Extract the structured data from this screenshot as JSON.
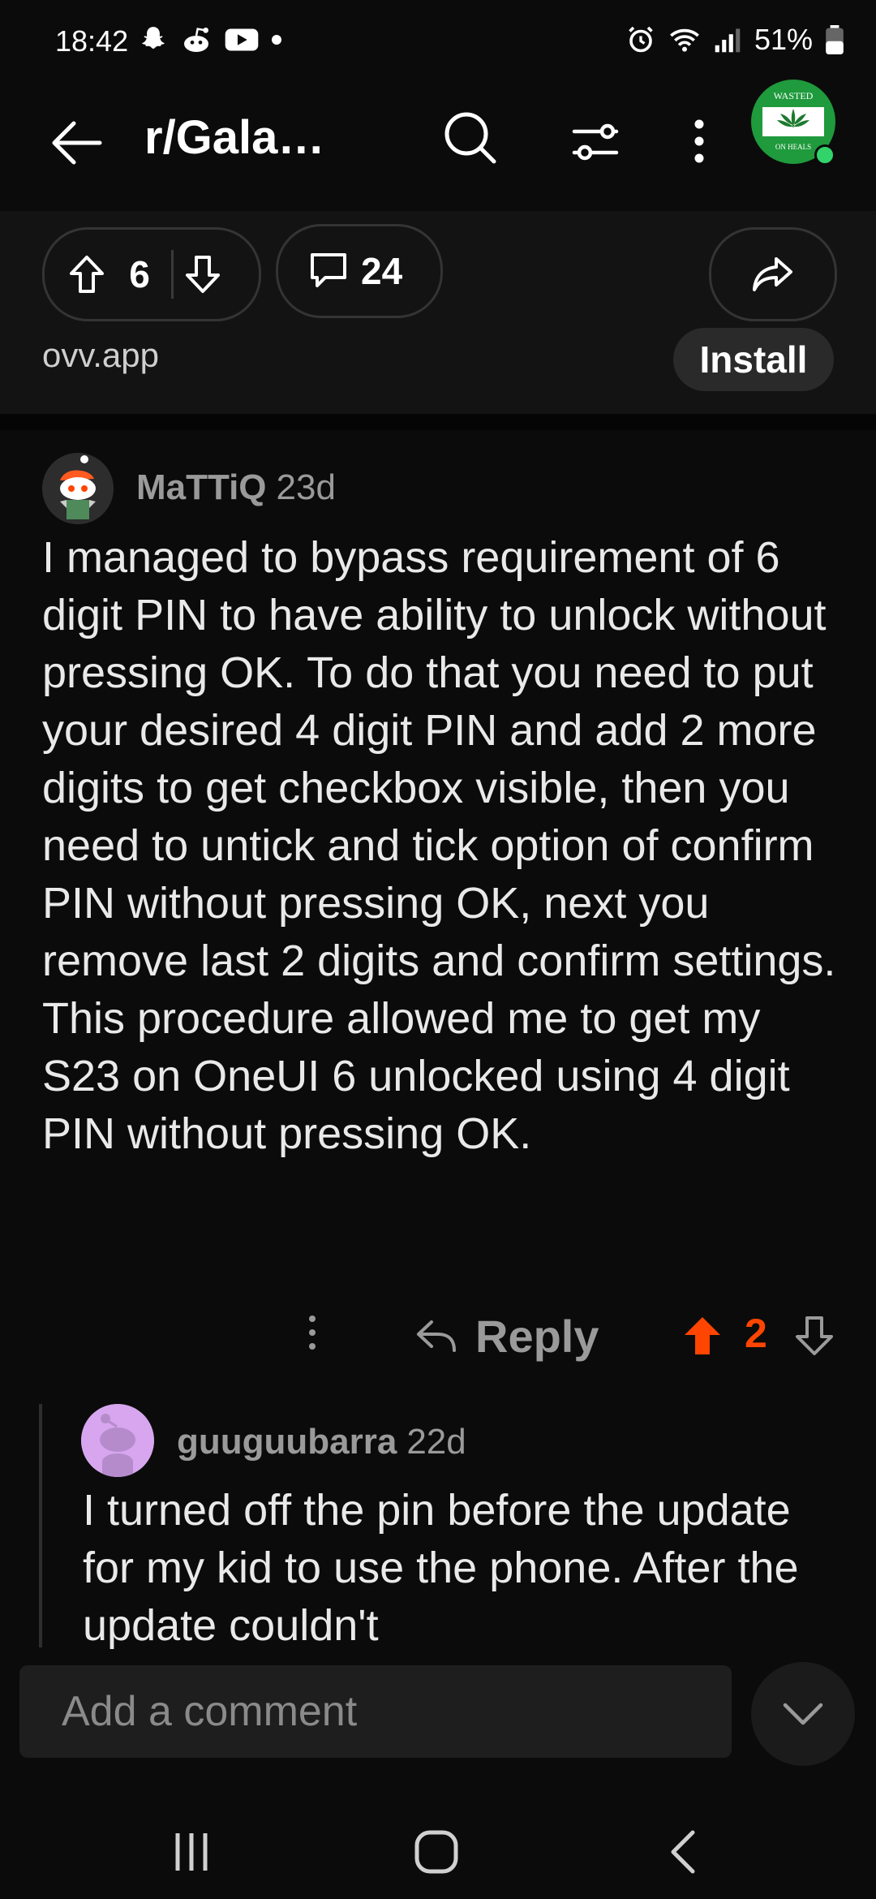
{
  "status_bar": {
    "time": "18:42",
    "battery": "51%"
  },
  "app_bar": {
    "title": "r/Gala…",
    "avatar_text_top": "WASTED",
    "avatar_text_bottom": "ON HEALS"
  },
  "post": {
    "votes": "6",
    "comments": "24",
    "domain": "ovv.app",
    "install_label": "Install"
  },
  "comment": {
    "author": "MaTTiQ",
    "age": "23d",
    "body": "I managed to bypass requirement of 6 digit PIN to have ability to unlock without pressing OK. To do that you need to put your desired 4 digit PIN and add 2 more digits to get checkbox visible, then you need to untick and tick option of confirm PIN without pressing OK, next you remove last 2 digits and confirm settings. This procedure allowed me to get my S23 on OneUI 6 unlocked using 4 digit PIN without pressing OK.",
    "reply_label": "Reply",
    "score": "2"
  },
  "reply": {
    "author": "guuguubarra",
    "age": "22d",
    "body": "I turned off the pin before the update for my kid to use the phone. After the update couldn't"
  },
  "comment_bar": {
    "placeholder": "Add a comment"
  },
  "colors": {
    "accent_upvote": "#ff4500",
    "background": "#0b0b0b"
  }
}
